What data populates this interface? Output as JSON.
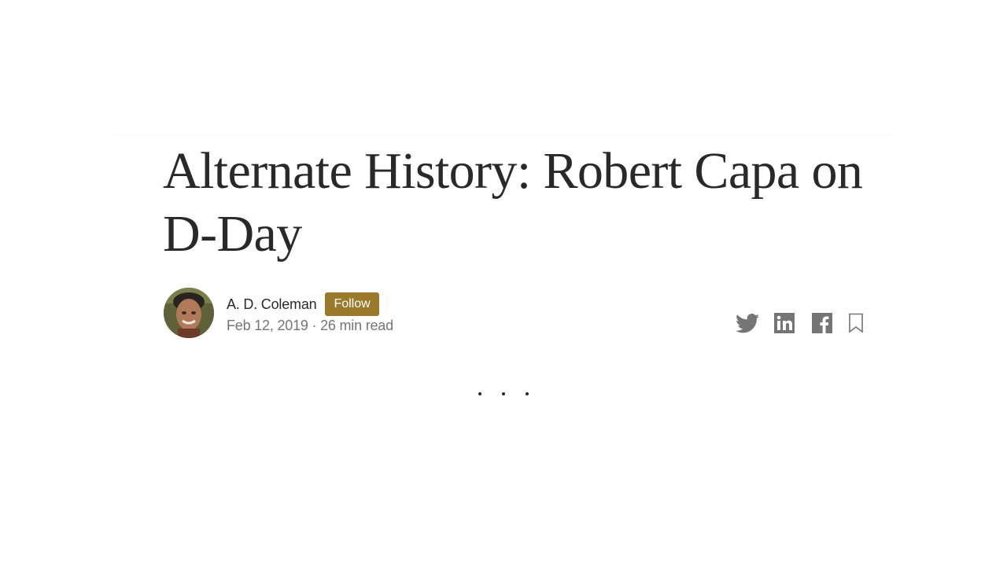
{
  "article": {
    "title": "Alternate History: Robert Capa on D-Day",
    "author": {
      "name": "A. D. Coleman",
      "follow_label": "Follow"
    },
    "meta": "Feb 12, 2019 · 26 min read"
  },
  "share": {
    "icons": [
      "twitter-icon",
      "linkedin-icon",
      "facebook-icon",
      "bookmark-icon"
    ]
  },
  "separator": "...",
  "colors": {
    "follow_button": "#9a7a2a",
    "text": "#292929",
    "muted": "#757575"
  }
}
